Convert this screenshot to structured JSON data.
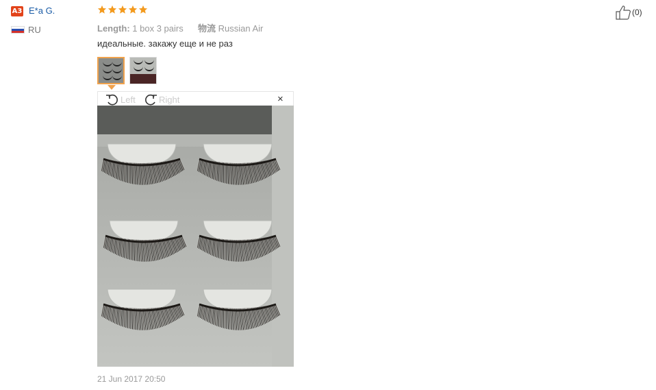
{
  "reviewer": {
    "badge": "A3",
    "name": "E*a G.",
    "country": "RU"
  },
  "rating": {
    "stars": 5,
    "max": 5,
    "color": "#f39a1e"
  },
  "properties": [
    {
      "key": "Length:",
      "value": "1 box 3 pairs"
    },
    {
      "key": "物流",
      "value": "Russian Air"
    }
  ],
  "review": {
    "text": "идеальные. закажу еще и не раз",
    "date": "21 Jun 2017 20:50"
  },
  "viewer": {
    "rotate_left_label": "Left",
    "rotate_right_label": "Right",
    "close_label": "×"
  },
  "helpful": {
    "count": "(0)"
  },
  "colors": {
    "accent": "#f1a24c",
    "link": "#1a5ba6",
    "badge": "#e2431a"
  }
}
